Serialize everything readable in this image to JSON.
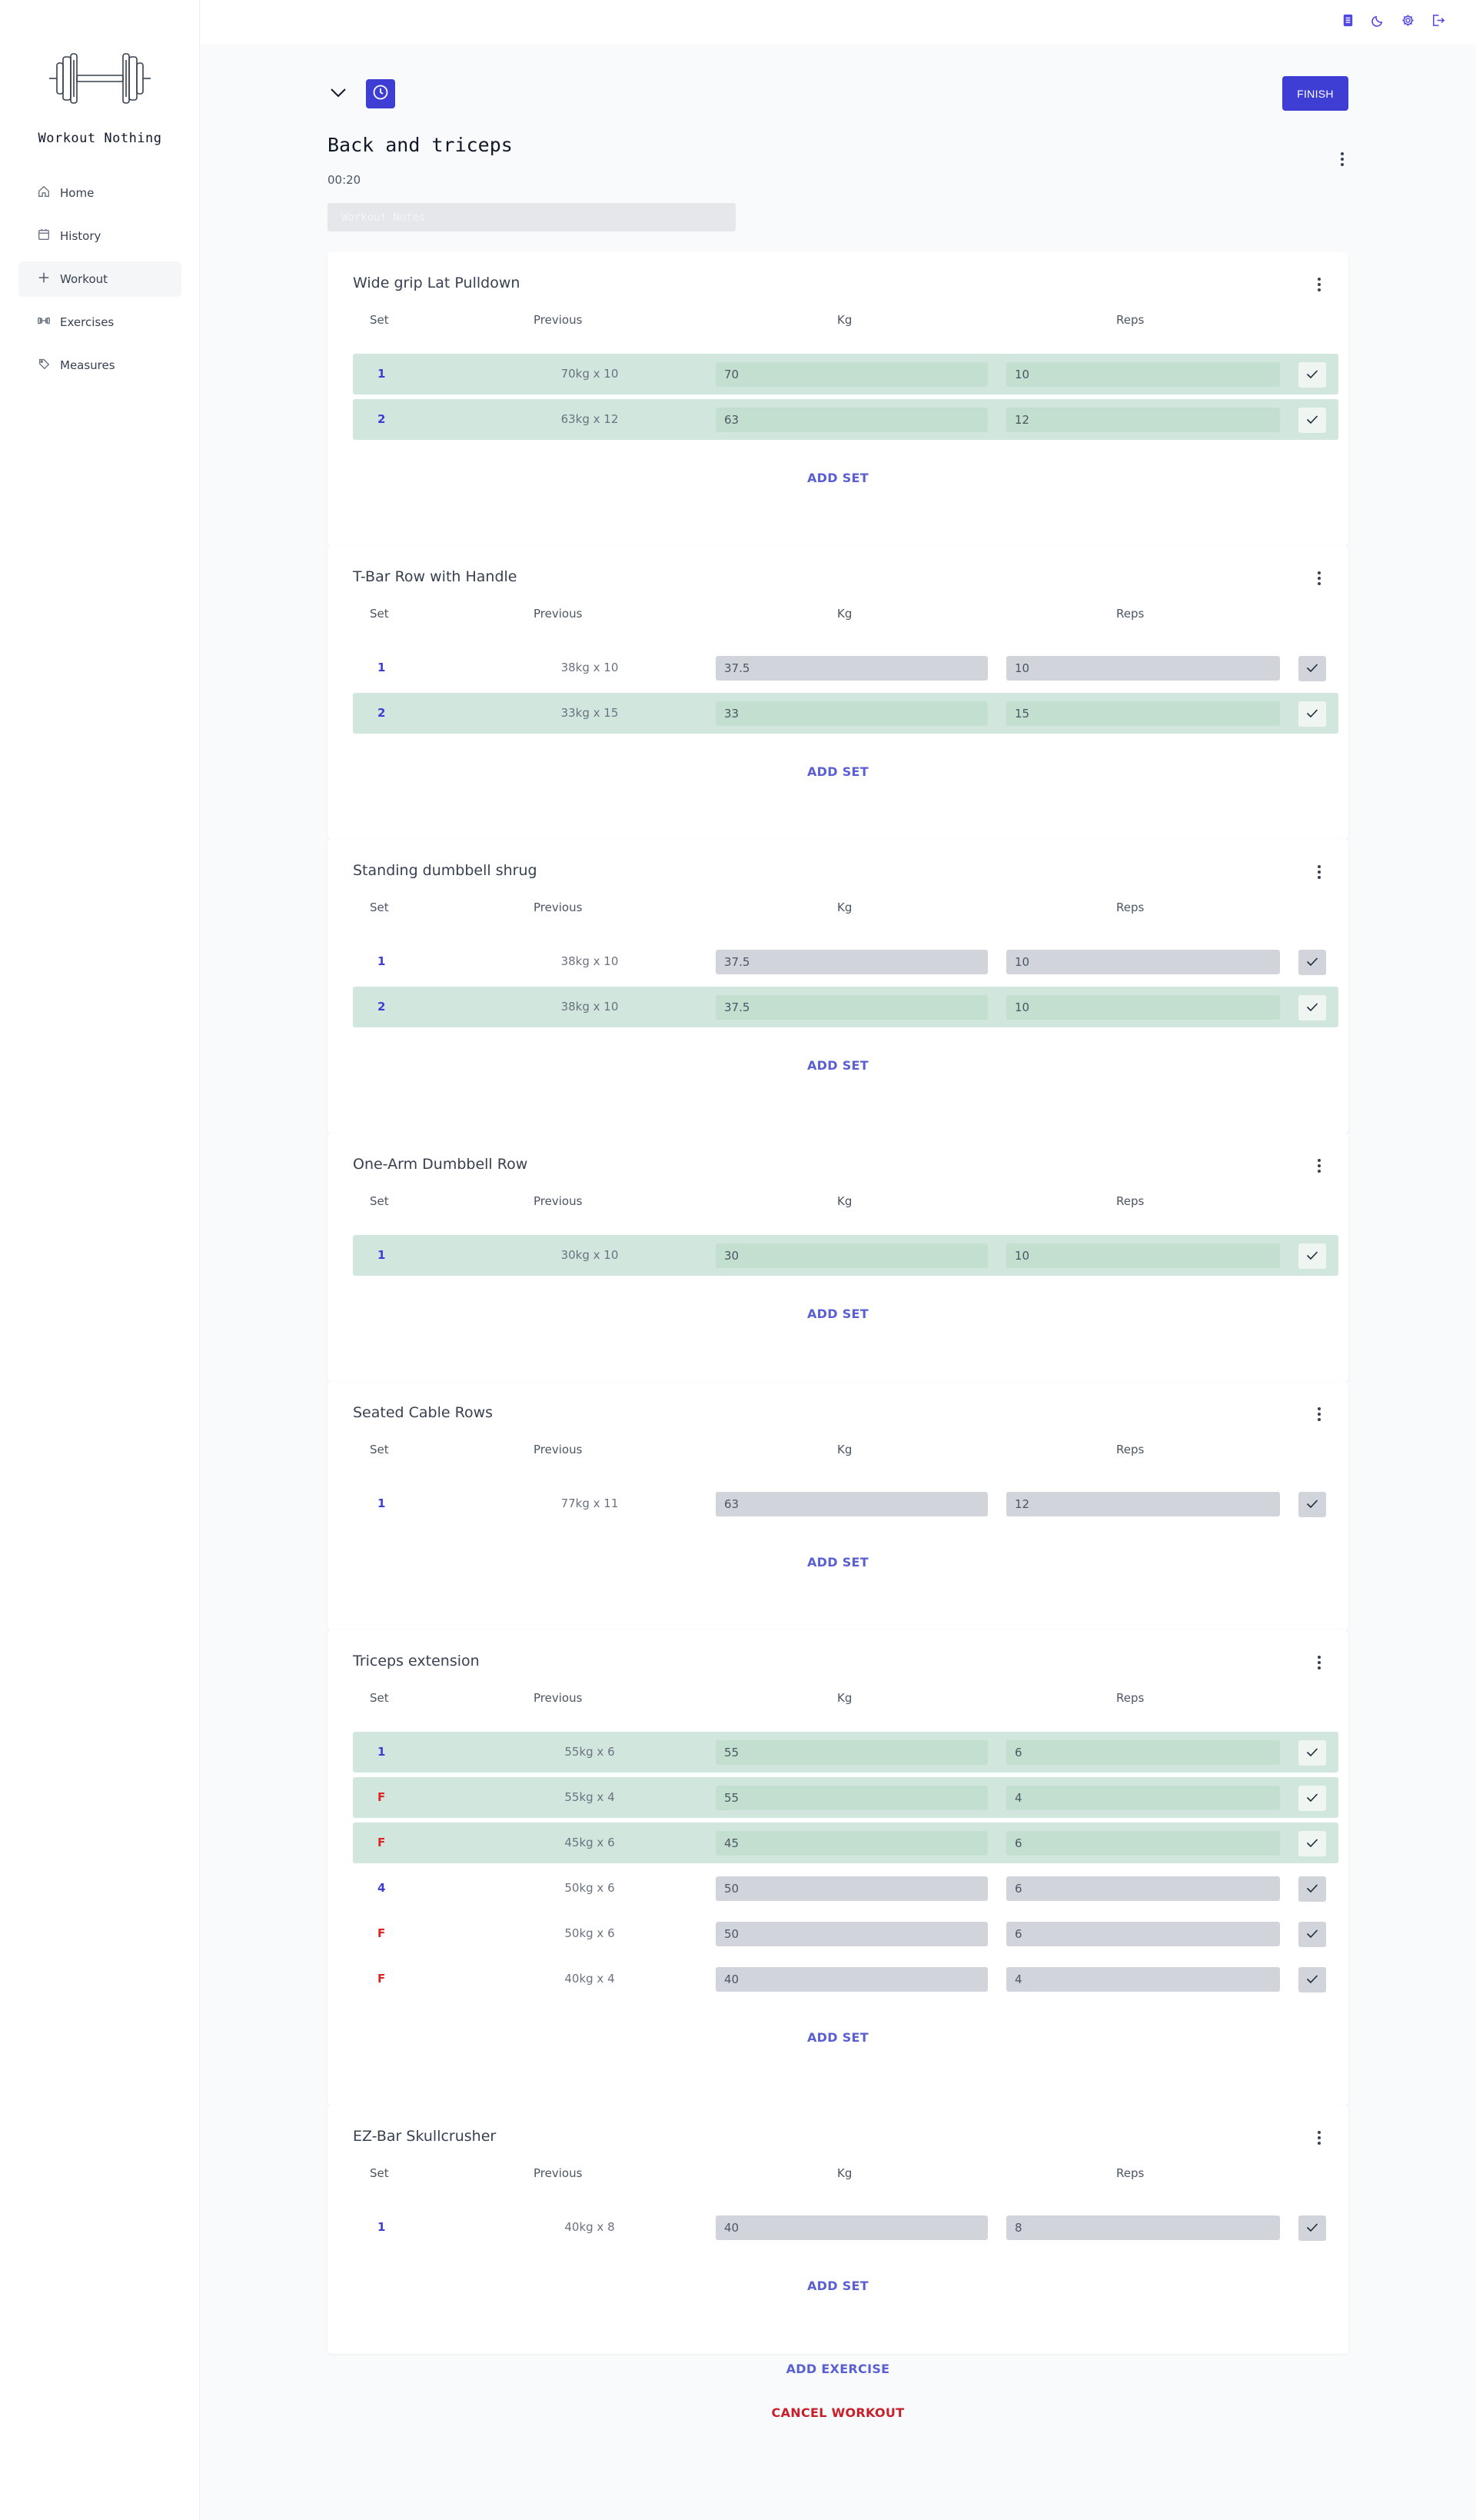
{
  "app": {
    "name": "Workout Nothing"
  },
  "sidebar": {
    "items": [
      {
        "label": "Home",
        "icon": "home-icon"
      },
      {
        "label": "History",
        "icon": "calendar-icon"
      },
      {
        "label": "Workout",
        "icon": "plus-icon",
        "active": true
      },
      {
        "label": "Exercises",
        "icon": "dumbbell-icon"
      },
      {
        "label": "Measures",
        "icon": "tape-icon"
      }
    ]
  },
  "topbar": {
    "icons": [
      "clipboard-icon",
      "moon-icon",
      "settings-icon",
      "logout-icon"
    ]
  },
  "workout": {
    "title": "Back and triceps",
    "elapsed": "00:20",
    "notes_placeholder": "Workout Notes",
    "finish_label": "FINISH"
  },
  "columns": {
    "set": "Set",
    "previous": "Previous",
    "kg": "Kg",
    "reps": "Reps"
  },
  "exercises": [
    {
      "name": "Wide grip Lat Pulldown",
      "add_set": "ADD SET",
      "sets": [
        {
          "set": "1",
          "previous": "70kg x 10",
          "kg": "70",
          "reps": "10",
          "done": true,
          "failure": false
        },
        {
          "set": "2",
          "previous": "63kg x 12",
          "kg": "63",
          "reps": "12",
          "done": true,
          "failure": false
        }
      ]
    },
    {
      "name": "T-Bar Row with Handle",
      "add_set": "ADD SET",
      "sets": [
        {
          "set": "1",
          "previous": "38kg x 10",
          "kg": "37.5",
          "reps": "10",
          "done": false,
          "failure": false
        },
        {
          "set": "2",
          "previous": "33kg x 15",
          "kg": "33",
          "reps": "15",
          "done": true,
          "failure": false
        }
      ]
    },
    {
      "name": "Standing dumbbell shrug",
      "add_set": "ADD SET",
      "sets": [
        {
          "set": "1",
          "previous": "38kg x 10",
          "kg": "37.5",
          "reps": "10",
          "done": false,
          "failure": false
        },
        {
          "set": "2",
          "previous": "38kg x 10",
          "kg": "37.5",
          "reps": "10",
          "done": true,
          "failure": false
        }
      ]
    },
    {
      "name": "One-Arm Dumbbell Row",
      "add_set": "ADD SET",
      "sets": [
        {
          "set": "1",
          "previous": "30kg x 10",
          "kg": "30",
          "reps": "10",
          "done": true,
          "failure": false
        }
      ]
    },
    {
      "name": "Seated Cable Rows",
      "add_set": "ADD SET",
      "sets": [
        {
          "set": "1",
          "previous": "77kg x 11",
          "kg": "63",
          "reps": "12",
          "done": false,
          "failure": false
        }
      ]
    },
    {
      "name": "Triceps extension",
      "add_set": "ADD SET",
      "sets": [
        {
          "set": "1",
          "previous": "55kg x 6",
          "kg": "55",
          "reps": "6",
          "done": true,
          "failure": false
        },
        {
          "set": "F",
          "previous": "55kg x 4",
          "kg": "55",
          "reps": "4",
          "done": true,
          "failure": true
        },
        {
          "set": "F",
          "previous": "45kg x 6",
          "kg": "45",
          "reps": "6",
          "done": true,
          "failure": true
        },
        {
          "set": "4",
          "previous": "50kg x 6",
          "kg": "50",
          "reps": "6",
          "done": false,
          "failure": false
        },
        {
          "set": "F",
          "previous": "50kg x 6",
          "kg": "50",
          "reps": "6",
          "done": false,
          "failure": true
        },
        {
          "set": "F",
          "previous": "40kg x 4",
          "kg": "40",
          "reps": "4",
          "done": false,
          "failure": true
        }
      ]
    },
    {
      "name": "EZ-Bar Skullcrusher",
      "add_set": "ADD SET",
      "sets": [
        {
          "set": "1",
          "previous": "40kg x 8",
          "kg": "40",
          "reps": "8",
          "done": false,
          "failure": false
        }
      ]
    }
  ],
  "actions": {
    "add_exercise": "ADD EXERCISE",
    "cancel_workout": "CANCEL WORKOUT"
  },
  "colors": {
    "accent": "#3f3ed4",
    "link": "#5a5fd3",
    "completed_row": "#d1e7dd",
    "failure": "#dc2626",
    "cancel": "#c81e2a"
  }
}
